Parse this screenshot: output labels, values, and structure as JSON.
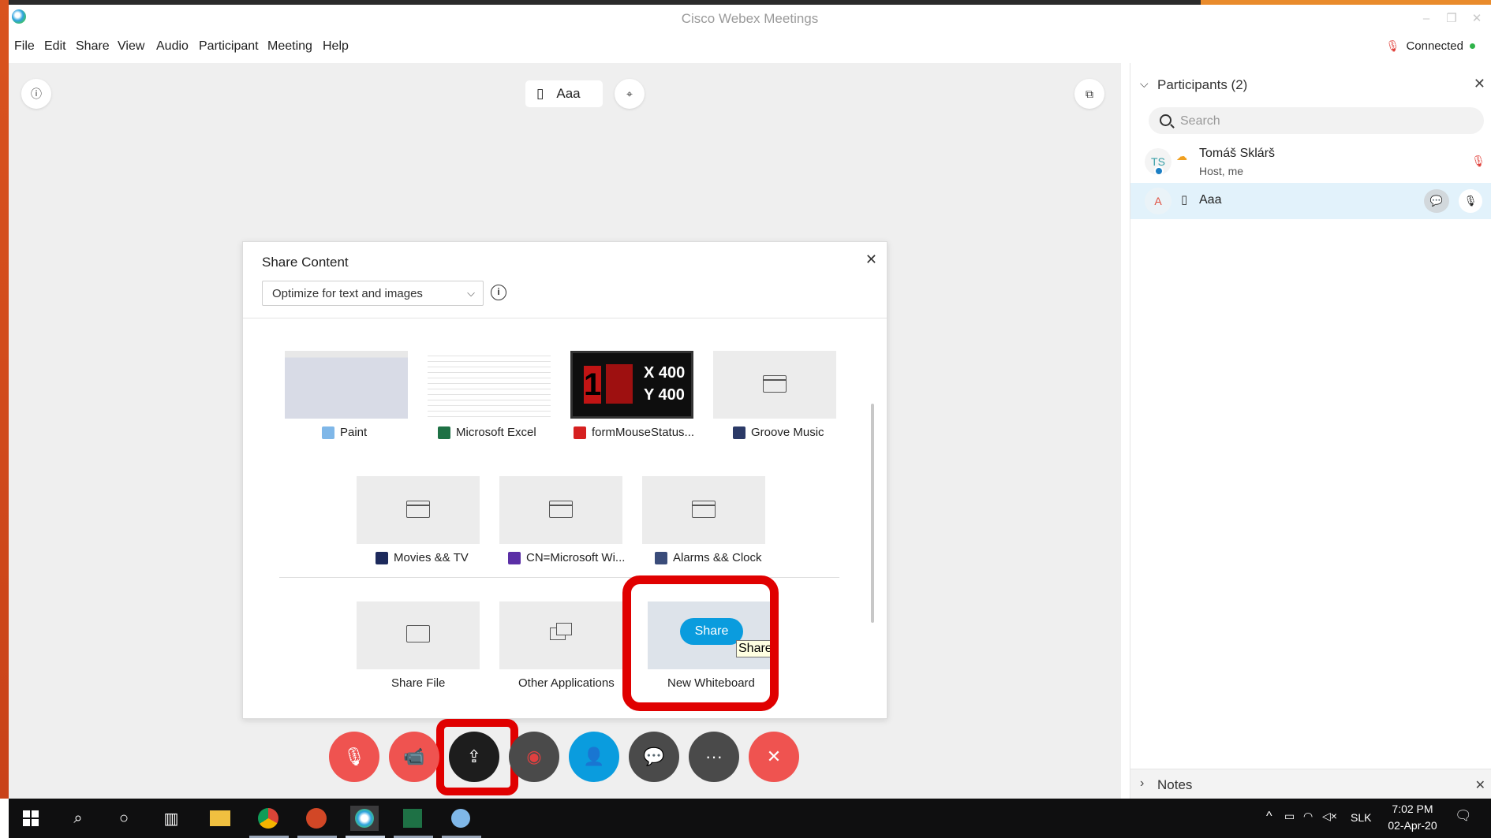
{
  "window": {
    "title": "Cisco Webex Meetings",
    "min": "–",
    "restore": "❐",
    "close": "✕"
  },
  "menu": [
    "File",
    "Edit",
    "Share",
    "View",
    "Audio",
    "Participant",
    "Meeting",
    "Help"
  ],
  "status": {
    "label": "Connected",
    "color": "#2fb34a"
  },
  "stage": {
    "info_icon": "ⓘ",
    "speaker_name": "Aaa",
    "speaker_device_icon": "▯",
    "pin_icon": "⌖",
    "popout_icon": "⧉"
  },
  "share_dialog": {
    "title": "Share Content",
    "close": "✕",
    "optimize_value": "Optimize for text and images",
    "optimize_chevron": "⌵",
    "info": "i",
    "apps": [
      {
        "label": "Paint",
        "icon_color": "#6aa84f"
      },
      {
        "label": "Microsoft Excel",
        "icon_color": "#1e7145"
      },
      {
        "label": "formMouseStatus...",
        "icon_color": "#d62020"
      },
      {
        "label": "Groove Music",
        "icon_color": "#2b3a67"
      },
      {
        "label": "Movies && TV",
        "icon_color": "#1d2a5c"
      },
      {
        "label": "CN=Microsoft Wi...",
        "icon_color": "#5b2fa6"
      },
      {
        "label": "Alarms && Clock",
        "icon_color": "#3a4c7a"
      }
    ],
    "form_thumb": {
      "left_glyph": "1",
      "x_text": "X 400",
      "y_text": "Y 400"
    },
    "share_file": "Share File",
    "other_apps": "Other Applications",
    "new_whiteboard": "New Whiteboard",
    "share_button": "Share",
    "tooltip": "Share"
  },
  "controls": {
    "mute": "🎙",
    "video": "📹",
    "share": "⇪",
    "record": "◉",
    "participants": "👤",
    "chat": "💬",
    "more": "···",
    "leave": "✕"
  },
  "participants": {
    "title": "Participants (2)",
    "chevron": "⌵",
    "close": "✕",
    "search_placeholder": "Search",
    "list": [
      {
        "initials": "TS",
        "name": "Tomáš Sklárš",
        "role": "Host, me"
      },
      {
        "initials": "A",
        "name": "Aaa",
        "role": ""
      }
    ],
    "notes": "Notes",
    "notes_chevron": "›"
  },
  "taskbar": {
    "time": "7:02 PM",
    "date": "02-Apr-20",
    "lang": "SLK",
    "tray_caret": "^",
    "notification_icon": "🗨"
  }
}
